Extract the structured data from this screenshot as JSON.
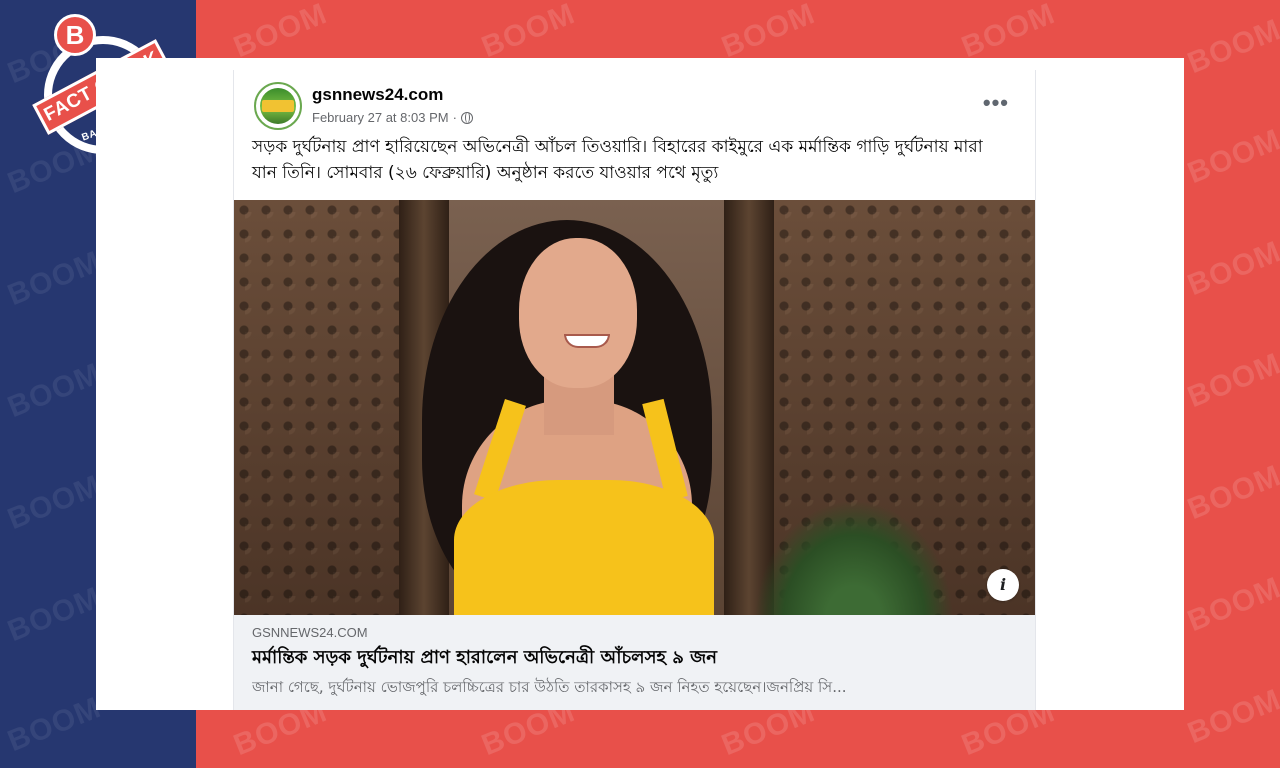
{
  "brand": {
    "badge_letter": "B",
    "badge_text": "FACT CHECK",
    "badge_country": "BANGLADESH",
    "watermark": "BOOM",
    "colors": {
      "navy": "#263770",
      "red": "#e8504a"
    }
  },
  "post": {
    "page_name": "gsnnews24.com",
    "timestamp": "February 27 at 8:03 PM",
    "separator": "·",
    "privacy_icon": "globe-icon",
    "more_label": "•••",
    "caption": "সড়ক দুর্ঘটনায় প্রাণ হারিয়েছেন অভিনেত্রী আঁচল তিওয়ারি। বিহারের কাইমুরে এক মর্মান্তিক গাড়ি দুর্ঘটনায় মারা যান তিনি। সোমবার (২৬  ফেব্রুয়ারি) অনুষ্ঠান করতে যাওয়ার পথে মৃত্যু",
    "info_label": "i"
  },
  "link_preview": {
    "domain": "GSNNEWS24.COM",
    "title": "মর্মান্তিক সড়ক দুর্ঘটনায় প্রাণ হারালেন অভিনেত্রী আঁচলসহ ৯ জন",
    "description": "জানা গেছে, দুর্ঘটনায় ভোজপুরি চলচ্চিত্রের চার উঠতি তারকাসহ ৯ জন নিহত হয়েছেন।জনপ্রিয় সি..."
  }
}
